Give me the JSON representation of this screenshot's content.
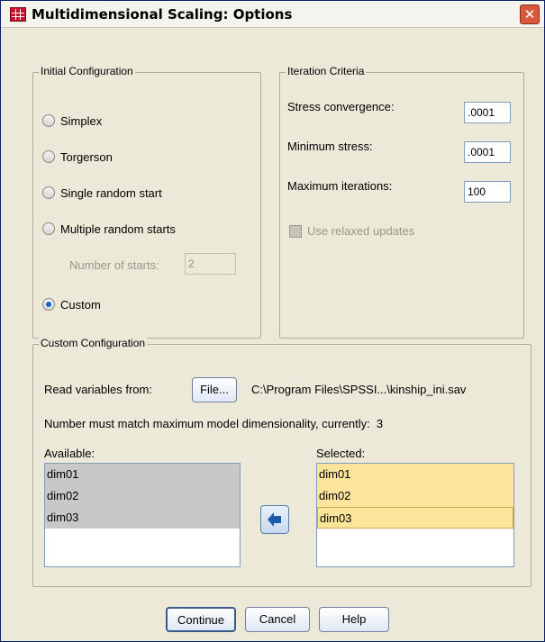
{
  "window": {
    "title": "Multidimensional Scaling: Options",
    "close_glyph": "✕"
  },
  "initial_configuration": {
    "legend": "Initial Configuration",
    "options": [
      {
        "label": "Simplex",
        "selected": false
      },
      {
        "label": "Torgerson",
        "selected": false
      },
      {
        "label": "Single random start",
        "selected": false
      },
      {
        "label": "Multiple random starts",
        "selected": false
      },
      {
        "label": "Custom",
        "selected": true
      }
    ],
    "number_of_starts_label": "Number of starts:",
    "number_of_starts_value": "2"
  },
  "iteration_criteria": {
    "legend": "Iteration Criteria",
    "stress_convergence_label": "Stress convergence:",
    "stress_convergence_value": ".0001",
    "minimum_stress_label": "Minimum stress:",
    "minimum_stress_value": ".0001",
    "maximum_iterations_label": "Maximum iterations:",
    "maximum_iterations_value": "100",
    "relaxed_updates_label": "Use relaxed updates"
  },
  "custom_configuration": {
    "legend": "Custom Configuration",
    "read_label": "Read variables from:",
    "file_button": "File...",
    "file_path": "C:\\Program Files\\SPSSI...\\kinship_ini.sav",
    "note": "Number must match maximum model dimensionality, currently:  3",
    "available_label": "Available:",
    "available_items": [
      "dim01",
      "dim02",
      "dim03"
    ],
    "selected_label": "Selected:",
    "selected_items": [
      "dim01",
      "dim02",
      "dim03"
    ]
  },
  "buttons": {
    "continue": "Continue",
    "cancel": "Cancel",
    "help": "Help"
  },
  "icons": {
    "app": "spss-grid-icon",
    "close": "close-icon",
    "move": "arrow-left-icon"
  },
  "colors": {
    "selected_list_bg": "#fce49a",
    "available_list_bg": "#c8c8c8",
    "close_red": "#d9573a"
  }
}
